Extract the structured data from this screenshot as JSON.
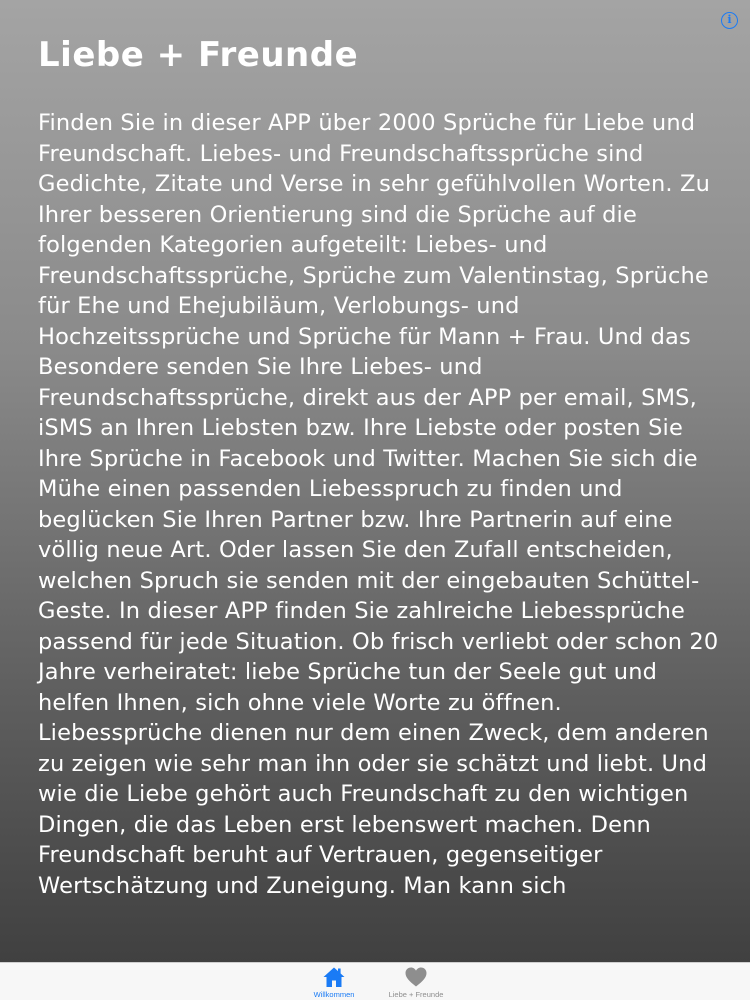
{
  "header": {
    "title": "Liebe + Freunde",
    "info_icon": "info-icon",
    "info_glyph": "i"
  },
  "main": {
    "description": "Finden Sie in dieser APP über 2000 Sprüche für Liebe und Freundschaft. Liebes- und Freundschaftssprüche sind Gedichte, Zitate und Verse in sehr gefühlvollen Worten. Zu Ihrer besseren Orientierung sind die Sprüche auf die folgenden Kategorien aufgeteilt: Liebes- und Freundschaftssprüche, Sprüche zum Valentinstag, Sprüche für Ehe und Ehejubiläum, Verlobungs- und Hochzeitssprüche und Sprüche für Mann + Frau. Und das Besondere senden Sie Ihre Liebes- und Freundschaftssprüche, direkt aus der APP per email, SMS, iSMS an Ihren Liebsten bzw. Ihre Liebste oder posten Sie Ihre Sprüche in Facebook und Twitter. Machen Sie sich die Mühe einen passenden Liebesspruch zu finden und beglücken Sie Ihren Partner bzw. Ihre Partnerin auf eine völlig neue Art. Oder lassen Sie den Zufall entscheiden, welchen Spruch sie senden mit der eingebauten Schüttel-Geste. In dieser APP finden Sie zahlreiche Liebessprüche passend für jede Situation. Ob frisch verliebt oder schon 20 Jahre verheiratet: liebe Sprüche tun der Seele gut und helfen Ihnen, sich ohne viele Worte zu öffnen. Liebessprüche dienen nur dem einen Zweck, dem anderen zu zeigen wie sehr man ihn oder sie schätzt und liebt. Und wie die Liebe gehört auch Freundschaft zu den wichtigen Dingen, die das Leben erst lebenswert machen. Denn Freundschaft beruht auf Vertrauen, gegenseitiger Wertschätzung und Zuneigung. Man kann sich"
  },
  "tabbar": {
    "tabs": [
      {
        "label": "Willkommen",
        "icon": "home-icon",
        "selected": true
      },
      {
        "label": "Liebe + Freunde",
        "icon": "heart-icon",
        "selected": false
      }
    ]
  },
  "colors": {
    "accent": "#1a7bf5",
    "inactive": "#8e8e8e",
    "text": "#ffffff",
    "tabbar_bg": "#f7f7f7"
  }
}
